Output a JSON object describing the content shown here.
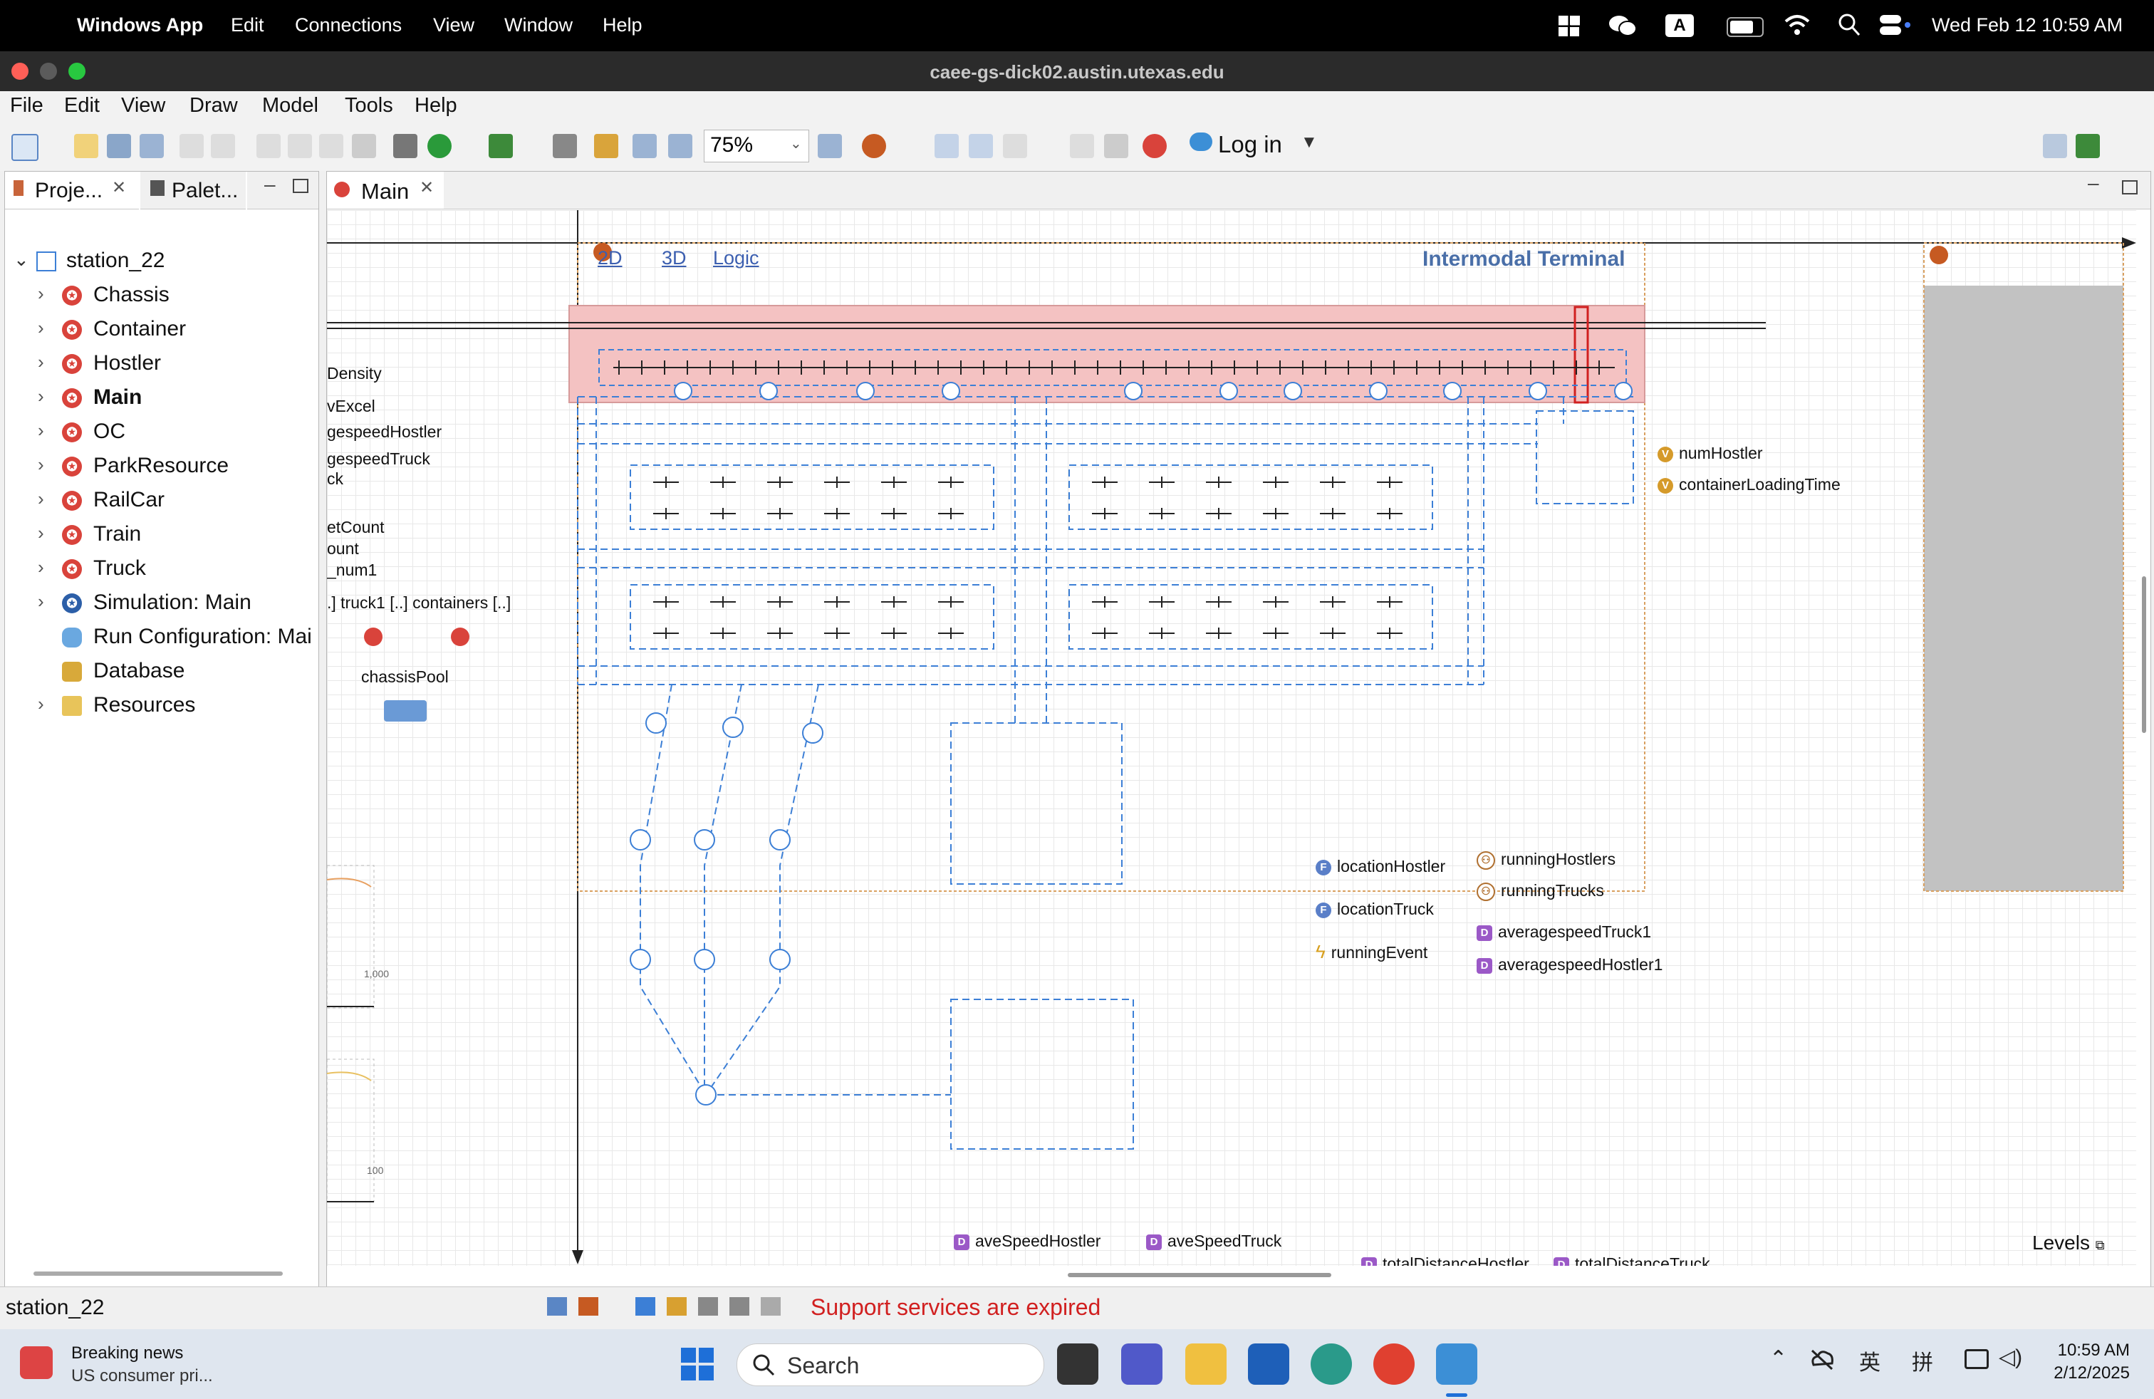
{
  "mac_menubar": {
    "app_name": "Windows App",
    "items": [
      "Edit",
      "Connections",
      "View",
      "Window",
      "Help"
    ],
    "clock": "Wed Feb 12  10:59 AM",
    "input_badge": "A"
  },
  "window": {
    "title": "caee-gs-dick02.austin.utexas.edu"
  },
  "app_menu": [
    "File",
    "Edit",
    "View",
    "Draw",
    "Model",
    "Tools",
    "Help"
  ],
  "toolbar": {
    "zoom": "75%",
    "login_label": "Log in"
  },
  "left_panel": {
    "tab_project": "Proje...",
    "tab_palette": "Palet...",
    "root": "station_22",
    "items": [
      {
        "label": "Chassis",
        "icon": "agent-icon",
        "bold": false
      },
      {
        "label": "Container",
        "icon": "agent-icon",
        "bold": false
      },
      {
        "label": "Hostler",
        "icon": "agent-icon",
        "bold": false
      },
      {
        "label": "Main",
        "icon": "agent-icon",
        "bold": true
      },
      {
        "label": "OC",
        "icon": "agent-icon",
        "bold": false
      },
      {
        "label": "ParkResource",
        "icon": "agent-icon",
        "bold": false
      },
      {
        "label": "RailCar",
        "icon": "agent-icon",
        "bold": false
      },
      {
        "label": "Train",
        "icon": "agent-icon",
        "bold": false
      },
      {
        "label": "Truck",
        "icon": "agent-icon",
        "bold": false
      },
      {
        "label": "Simulation: Main",
        "icon": "simulation-icon",
        "bold": false
      },
      {
        "label": "Run Configuration: Mai",
        "icon": "run-config-icon",
        "bold": false
      },
      {
        "label": "Database",
        "icon": "database-icon",
        "bold": false
      },
      {
        "label": "Resources",
        "icon": "folder-icon",
        "bold": false
      }
    ]
  },
  "editor": {
    "tab_label": "Main",
    "view_links": [
      "2D",
      "3D",
      "Logic"
    ],
    "terminal_title": "Intermodal Terminal",
    "left_labels": [
      "Density",
      "vExcel",
      "gespeedHostler",
      "gespeedTruck",
      "ck",
      "etCount",
      "ount",
      "_num1",
      ".]  truck1 [..]  containers [..]",
      "chassisPool"
    ],
    "axis_ticks": [
      "1,000",
      "100"
    ],
    "params": [
      "numHostler",
      "containerLoadingTime"
    ],
    "functions": [
      "locationHostler",
      "locationTruck"
    ],
    "event": "runningEvent",
    "collections": [
      "runningHostlers",
      "runningTrucks"
    ],
    "datasets": [
      "averagespeedTruck1",
      "averagespeedHostler1"
    ],
    "bottom_datasets": [
      "aveSpeedHostler",
      "aveSpeedTruck",
      "totalDistanceHostler",
      "totalDistanceTruck"
    ],
    "levels_label": "Levels"
  },
  "status": {
    "left": "station_22",
    "message": "Support services are expired"
  },
  "taskbar": {
    "news_title": "Breaking news",
    "news_sub": "US consumer pri...",
    "search_placeholder": "Search",
    "tray_lang1": "英",
    "tray_lang2": "拼",
    "time": "10:59 AM",
    "date": "2/12/2025"
  },
  "colors": {
    "accent": "#3c7fd6",
    "agent_red": "#d9433b",
    "status_red": "#d12020",
    "rail_pink": "#f4c2c2"
  }
}
